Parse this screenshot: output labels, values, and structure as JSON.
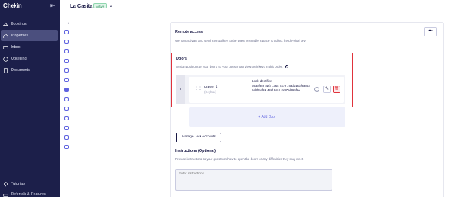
{
  "brand": "Chekin",
  "sidebar": {
    "items": [
      {
        "label": "Bookings",
        "icon": "bookings-icon",
        "active": false
      },
      {
        "label": "Properties",
        "icon": "properties-icon",
        "active": true
      },
      {
        "label": "Inbox",
        "icon": "inbox-icon",
        "active": false
      },
      {
        "label": "Upselling",
        "icon": "upselling-icon",
        "active": false
      },
      {
        "label": "Documents",
        "icon": "documents-icon",
        "active": false
      }
    ],
    "bottom": [
      {
        "label": "Tutorials",
        "icon": "lightbulb-icon"
      },
      {
        "label": "Referrals & Features",
        "icon": "gift-icon"
      }
    ]
  },
  "header": {
    "property_name": "La Casita",
    "status_badge": "Active"
  },
  "remote_access": {
    "title": "Remote access",
    "description": "We can activate and send a virtual key to the guest or enable a place to collect the physical key.",
    "more_label": "•••"
  },
  "doors": {
    "title": "Doors",
    "description": "Assign positions to your doors so your guests can view their keys in this order.",
    "info": "?",
    "rows": [
      {
        "index": "1",
        "name": "drawer 1",
        "type": "(Keybox)",
        "lock_label": "Lock identifier:",
        "lock_id": "3543f306-32fe-4e5e-b647-473dd16fef9383e0d9f0-ef31-496f-8ce7-2e97cd855f5a"
      }
    ],
    "add_label": "+ Add Door"
  },
  "manage_lock_accounts": "Manage Lock Accounts",
  "instructions": {
    "title": "Instructions (Optional)",
    "description": "Provide instructions to your guests on how to open the doors or any difficulties they may meet.",
    "placeholder": "Enter instructions"
  },
  "colors": {
    "sidebar_bg": "#1c1f4a",
    "accent": "#5f63e0",
    "highlight_border": "#e0333c",
    "active_badge": "#2b8c59"
  }
}
